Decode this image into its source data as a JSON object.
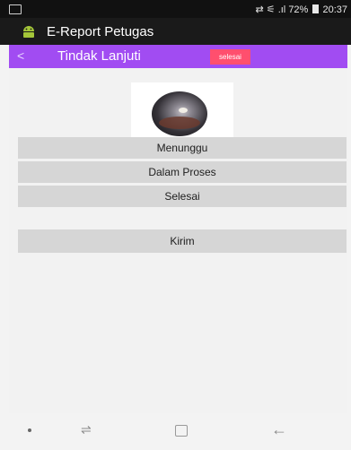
{
  "status_bar": {
    "icons": [
      "screenshot-icon",
      "vibrate-icon",
      "signal-icon",
      "battery-icon"
    ],
    "battery": "72%",
    "time": "20:37",
    "indicators": "⇄ ⚟ .ıl"
  },
  "app_bar": {
    "icon": "android-icon",
    "title": "E-Report Petugas"
  },
  "toolbar": {
    "back_icon": "back-chevron-icon",
    "title": "Tindak Lanjuti",
    "badge": "selesai"
  },
  "buttons": {
    "menunggu": "Menunggu",
    "dalam_proses": "Dalam Proses",
    "selesai": "Selesai",
    "kirim": "Kirim"
  },
  "nav_bar": {
    "icons": [
      "dot-icon",
      "recents-icon",
      "home-icon",
      "back-arrow-icon"
    ]
  },
  "colors": {
    "toolbar": "#a14cf2",
    "badge": "#ff4f6e",
    "button": "#d6d6d6",
    "background": "#f2f2f2"
  }
}
